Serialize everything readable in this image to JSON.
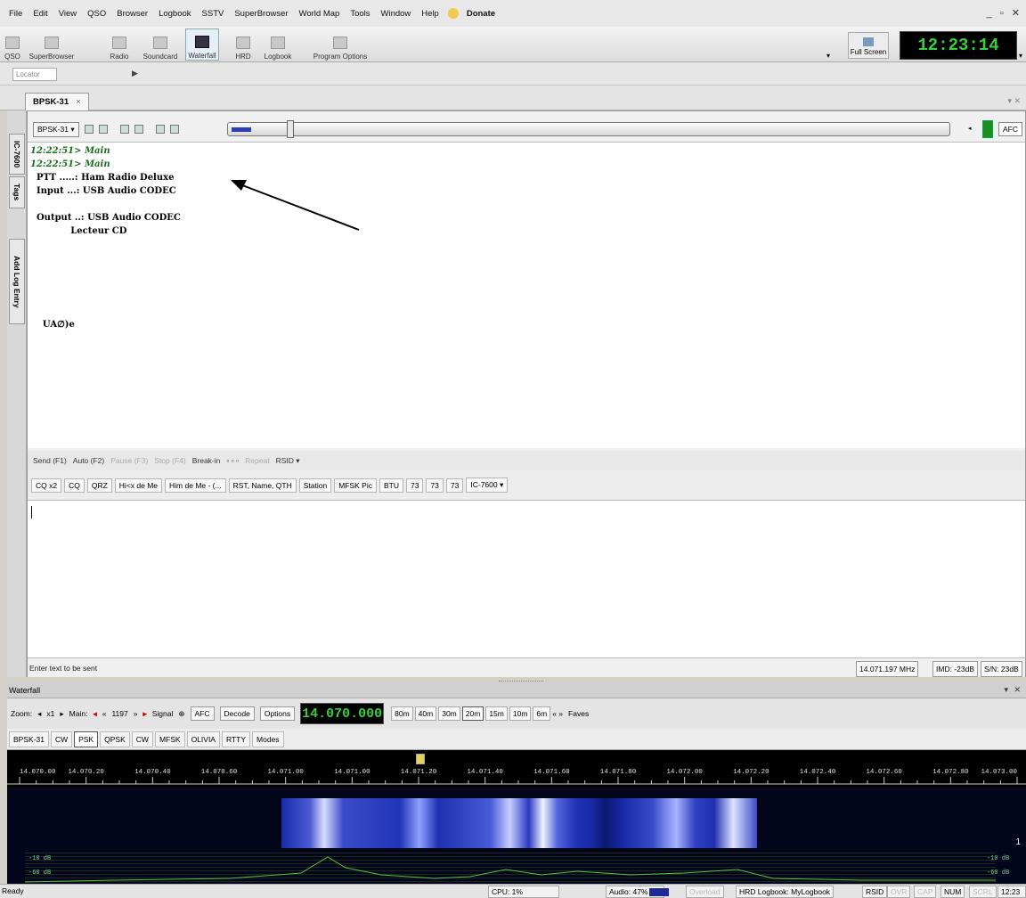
{
  "menu": {
    "items": [
      "File",
      "Edit",
      "View",
      "QSO",
      "Browser",
      "Logbook",
      "SSTV",
      "SuperBrowser",
      "World Map",
      "Tools",
      "Window",
      "Help"
    ],
    "donate": "Donate",
    "window_controls": "_ ▫ ✕"
  },
  "toolbar": {
    "buttons": [
      "QSO",
      "SuperBrowser",
      "Radio",
      "Soundcard",
      "Waterfall",
      "HRD",
      "Logbook",
      "Program Options"
    ],
    "full_screen": "Full Screen",
    "clock": "12:23:14"
  },
  "locator": {
    "placeholder": "Locator"
  },
  "doc_tab": {
    "label": "BPSK-31",
    "close": "×"
  },
  "side_tabs": {
    "radio": "IC-7600",
    "tags": "Tags",
    "add_log": "Add Log Entry"
  },
  "psk": {
    "mode": "BPSK-31 ▾",
    "afc": "AFC",
    "rx_lines": [
      {
        "ts": "12:22:51> Main",
        "text": ""
      },
      {
        "ts": "12:22:51> Main",
        "text": ""
      },
      {
        "ts": "",
        "text": "  PTT .....: Ham Radio Deluxe"
      },
      {
        "ts": "",
        "text": "  Input ...: USB Audio CODEC"
      },
      {
        "ts": "",
        "text": ""
      },
      {
        "ts": "",
        "text": "  Output ..: USB Audio CODEC"
      },
      {
        "ts": "",
        "text": "             Lecteur CD"
      },
      {
        "ts": "",
        "text": ""
      },
      {
        "ts": "",
        "text": ""
      },
      {
        "ts": "",
        "text": ""
      },
      {
        "ts": "",
        "text": ""
      },
      {
        "ts": "",
        "text": ""
      },
      {
        "ts": "",
        "text": "    UA∅)e"
      }
    ]
  },
  "tx_toolbar": {
    "send": "Send (F1)",
    "auto": "Auto (F2)",
    "pause": "Pause (F3)",
    "stop": "Stop (F4)",
    "break_in": "Break-in",
    "repeat": "Repeat",
    "rsid": "RSID ▾"
  },
  "macros": [
    "CQ x2",
    "CQ",
    "QRZ",
    "Hi<x de Me",
    "Him de Me - (...",
    "RST, Name, QTH",
    "Station",
    "MFSK Pic",
    "BTU",
    "73",
    "73",
    "73",
    "IC-7600 ▾"
  ],
  "tx_status": {
    "hint": "Enter text to be sent",
    "freq": "14.071.197 MHz",
    "imd": "IMD: -23dB",
    "sn": "S/N: 23dB"
  },
  "waterfall": {
    "title": "Waterfall",
    "controls": "▾ ✕",
    "zoom_label": "Zoom:",
    "zoom_val": "x1",
    "main_label": "Main:",
    "main_val": "1197",
    "signal_label": "Signal",
    "afc": "AFC",
    "decode": "Decode",
    "options": "Options",
    "frequency": "14.070.000",
    "bands": [
      "80m",
      "40m",
      "30m",
      "20m",
      "15m",
      "10m",
      "6m"
    ],
    "selected_band": "20m",
    "faves": "Faves",
    "mode_tabs": [
      "BPSK-31",
      "CW",
      "PSK",
      "QPSK",
      "CW",
      "MFSK",
      "OLIVIA",
      "RTTY",
      "Modes"
    ],
    "selected_mode": "PSK",
    "scale": [
      "14.070.00",
      "14.070.20",
      "14.070.40",
      "14.070.60",
      "14.071.00",
      "14.071.00",
      "14.071.20",
      "14.071.40",
      "14.071.60",
      "14.071.80",
      "14.072.00",
      "14.072.20",
      "14.072.40",
      "14.072.60",
      "14.072.80",
      "14.073.00"
    ],
    "db_left": [
      "-10 dB",
      "-60 dB"
    ],
    "db_right": [
      "-10 dB",
      "-60 dB"
    ],
    "side_marker": "1"
  },
  "statusbar": {
    "ready": "Ready",
    "cpu": "CPU: 1%",
    "audio": "Audio: 47%",
    "overload": "Overload",
    "logbook": "HRD Logbook: MyLogbook",
    "rsid": "RSID",
    "ovr": "OVR",
    "cap": "CAP",
    "num": "NUM",
    "scrl": "SCRL",
    "time": "12:23"
  },
  "colors": {
    "clock_green": "#35d13a",
    "timestamp_green": "#1c6e1e",
    "signal_blue": "#2b3fb3"
  }
}
